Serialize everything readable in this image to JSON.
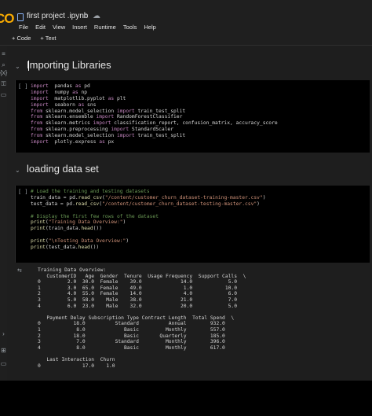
{
  "header": {
    "logo": "CO",
    "title": "first project .ipynb",
    "icons": [
      "star-icon",
      "cloud-icon"
    ],
    "menu": [
      "File",
      "Edit",
      "View",
      "Insert",
      "Runtime",
      "Tools",
      "Help"
    ],
    "toolbar": [
      "+ Code",
      "+ Text"
    ]
  },
  "sidebar": {
    "icons": [
      "menu-icon",
      "search-icon",
      "code-icon",
      "key-icon",
      "folder-icon",
      "expand-icon",
      "code-snippets-icon",
      "terminal-icon"
    ]
  },
  "sections": [
    {
      "title": "Importing Libraries",
      "cell": {
        "bracket": "[ ]",
        "lines": [
          [
            [
              "kw",
              "import"
            ],
            [
              "",
              "  pandas "
            ],
            [
              "kw",
              "as"
            ],
            [
              "",
              " pd"
            ]
          ],
          [
            [
              "kw",
              "import"
            ],
            [
              "",
              "  numpy "
            ],
            [
              "kw",
              "as"
            ],
            [
              "",
              " np"
            ]
          ],
          [
            [
              "kw",
              "import"
            ],
            [
              "",
              "  matplotlib.pyplot "
            ],
            [
              "kw",
              "as"
            ],
            [
              "",
              " plt"
            ]
          ],
          [
            [
              "kw",
              "import"
            ],
            [
              "",
              "  seaborn "
            ],
            [
              "kw",
              "as"
            ],
            [
              "",
              " sns"
            ]
          ],
          [
            [
              "kw",
              "from"
            ],
            [
              "",
              " sklearn.model_selection "
            ],
            [
              "kw",
              "import"
            ],
            [
              "",
              " train_test_split"
            ]
          ],
          [
            [
              "kw",
              "from"
            ],
            [
              "",
              " sklearn.ensemble "
            ],
            [
              "kw",
              "import"
            ],
            [
              "",
              " RandomForestClassifier"
            ]
          ],
          [
            [
              "kw",
              "from"
            ],
            [
              "",
              " sklearn.metrics "
            ],
            [
              "kw",
              "import"
            ],
            [
              "",
              " classification_report, confusion_matrix, accuracy_score"
            ]
          ],
          [
            [
              "kw",
              "from"
            ],
            [
              "",
              " sklearn.preprocessing "
            ],
            [
              "kw",
              "import"
            ],
            [
              "",
              " StandardScaler"
            ]
          ],
          [
            [
              "kw",
              "from"
            ],
            [
              "",
              " sklearn.model_selection "
            ],
            [
              "kw",
              "import"
            ],
            [
              "",
              " train_test_split"
            ]
          ],
          [
            [
              "kw",
              "import"
            ],
            [
              "",
              "  plotly.express "
            ],
            [
              "kw",
              "as"
            ],
            [
              "",
              " px"
            ]
          ]
        ]
      }
    },
    {
      "title": "loading data set",
      "cell": {
        "bracket": "[ ]",
        "lines": [
          [
            [
              "cm",
              "# Load the training and testing datasets"
            ]
          ],
          [
            [
              "",
              "train_data = pd."
            ],
            [
              "fn",
              "read_csv"
            ],
            [
              "",
              "("
            ],
            [
              "str",
              "\"/content/customer_churn_dataset-training-master.csv\""
            ],
            [
              "",
              ")"
            ]
          ],
          [
            [
              "",
              "test_data = pd."
            ],
            [
              "fn",
              "read_csv"
            ],
            [
              "",
              "("
            ],
            [
              "str",
              "\"/content/customer_churn_dataset-testing-master.csv\""
            ],
            [
              "",
              ")"
            ]
          ],
          [
            [
              "",
              ""
            ]
          ],
          [
            [
              "cm",
              "# Display the first few rows of the dataset"
            ]
          ],
          [
            [
              "fn",
              "print"
            ],
            [
              "",
              "("
            ],
            [
              "str",
              "\"Training Data Overview:\""
            ],
            [
              "",
              ")"
            ]
          ],
          [
            [
              "fn",
              "print"
            ],
            [
              "",
              "(train_data."
            ],
            [
              "fn",
              "head"
            ],
            [
              "",
              "())"
            ]
          ],
          [
            [
              "",
              ""
            ]
          ],
          [
            [
              "fn",
              "print"
            ],
            [
              "",
              "("
            ],
            [
              "str",
              "\"\\nTesting Data Overview:\""
            ],
            [
              "",
              ")"
            ]
          ],
          [
            [
              "fn",
              "print"
            ],
            [
              "",
              "(test_data."
            ],
            [
              "fn",
              "head"
            ],
            [
              "",
              "())"
            ]
          ]
        ]
      }
    }
  ],
  "output": {
    "lines": [
      "Training Data Overview:",
      "   CustomerID   Age  Gender  Tenure  Usage Frequency  Support Calls  \\",
      "0         2.0  30.0  Female    39.0             14.0            5.0",
      "1         3.0  65.0  Female    49.0              1.0           10.0",
      "2         4.0  55.0  Female    14.0              4.0            6.0",
      "3         5.0  58.0    Male    38.0             21.0            7.0",
      "4         6.0  23.0    Male    32.0             20.0            5.0",
      "",
      "   Payment Delay Subscription Type Contract Length  Total Spend  \\",
      "0           18.0          Standard          Annual        932.0",
      "1            8.0             Basic         Monthly        557.0",
      "2           18.0             Basic       Quarterly        185.0",
      "3            7.0          Standard         Monthly        396.0",
      "4            8.0             Basic         Monthly        617.0",
      "",
      "   Last Interaction  Churn",
      "0              17.0    1.0"
    ]
  }
}
